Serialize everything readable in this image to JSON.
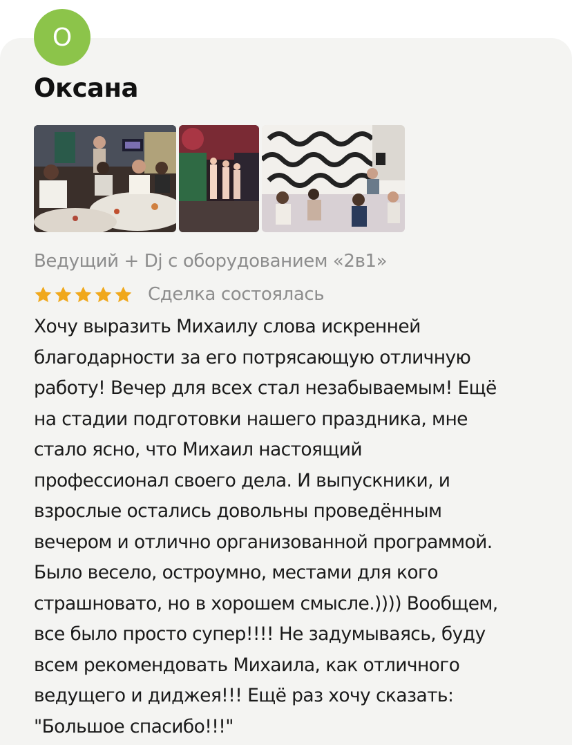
{
  "author": {
    "avatar_letter": "О",
    "avatar_color": "#8cc44a",
    "name": "Оксана"
  },
  "photos": [
    {
      "icon": "party-photo-icon",
      "description_name": "photo-1"
    },
    {
      "icon": "party-photo-icon",
      "description_name": "photo-2"
    },
    {
      "icon": "party-photo-icon",
      "description_name": "photo-3"
    }
  ],
  "service": "Ведущий + Dj с оборудованием «2в1»",
  "rating": {
    "stars": 5,
    "max": 5,
    "star_color": "#f0a81c"
  },
  "deal_status": "Сделка состоялась",
  "review_text": "Хочу выразить Михаилу слова искренней\nблагодарности за его потрясающую отличную\nработу! Вечер для всех стал незабываемым! Ещё\nна стадии подготовки нашего праздника, мне\nстало ясно, что Михаил настоящий\nпрофессионал своего дела. И выпускники, и\nвзрослые остались довольны проведённым\nвечером и отлично организованной программой.\nБыло весело, остроумно, местами для кого\nстрашновато, но в хорошем смысле.)))) Вообщем,\nвсе было просто супер!!!! Не задумываясь, буду\nвсем рекомендовать Михаила, как отличного\nведущего и диджея!!! Ещё раз хочу сказать:\n\"Большое спасибо!!!\""
}
